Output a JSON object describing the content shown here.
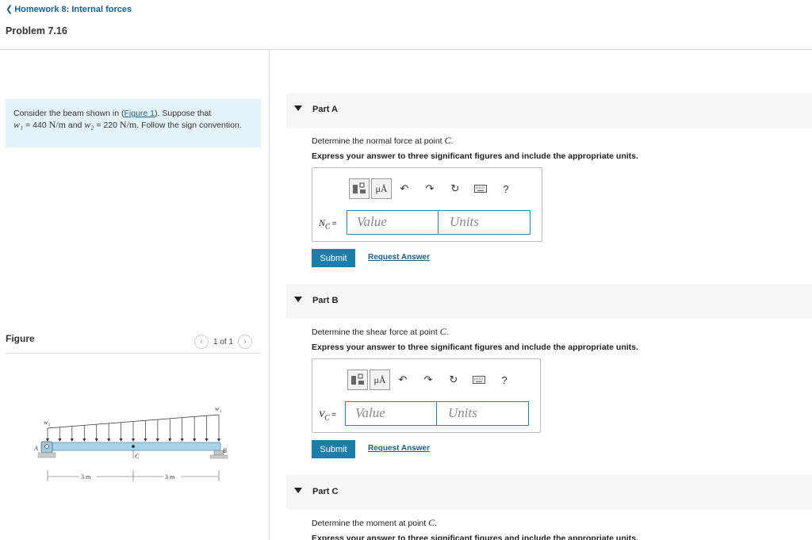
{
  "header": {
    "back_label": "Homework 8: Internal forces",
    "problem_title": "Problem 7.16"
  },
  "problem": {
    "text_1": "Consider the beam shown in (",
    "figure_link": "Figure 1",
    "text_2": "). Suppose that",
    "w1": "w₁",
    "w1_eq": " = 440 ",
    "w1_unit": "N/m",
    "text_and": " and ",
    "w2": "w₂",
    "w2_eq": " = 220 ",
    "w2_unit": "N/m",
    "text_3": ". Follow the sign convention."
  },
  "figure": {
    "label": "Figure",
    "pager": "1 of 1",
    "labels": {
      "w2": "w",
      "w2_sub": "2",
      "w1": "w",
      "w1_sub": "1",
      "a": "A",
      "b": "B",
      "c": "C",
      "dim1": "3 m",
      "dim2": "3 m"
    }
  },
  "parts": [
    {
      "title": "Part A",
      "prompt_pre": "Determine the normal force at point ",
      "prompt_var": "C",
      "prompt_post": ".",
      "instruction": "Express your answer to three significant figures and include the appropriate units.",
      "var_main": "N",
      "var_sub": "C",
      "var_eq": " =",
      "value_placeholder": "Value",
      "units_placeholder": "Units",
      "submit": "Submit",
      "request": "Request Answer"
    },
    {
      "title": "Part B",
      "prompt_pre": "Determine the shear force at point ",
      "prompt_var": "C",
      "prompt_post": ".",
      "instruction": "Express your answer to three significant figures and include the appropriate units.",
      "var_main": "V",
      "var_sub": "C",
      "var_eq": " =",
      "value_placeholder": "Value",
      "units_placeholder": "Units",
      "submit": "Submit",
      "request": "Request Answer"
    },
    {
      "title": "Part C",
      "prompt_pre": "Determine the moment at point ",
      "prompt_var": "C",
      "prompt_post": ".",
      "instruction": "Express your answer to three significant figures and include the appropriate units."
    }
  ],
  "toolbar": {
    "units_glyph": "μÅ",
    "help_glyph": "?"
  }
}
